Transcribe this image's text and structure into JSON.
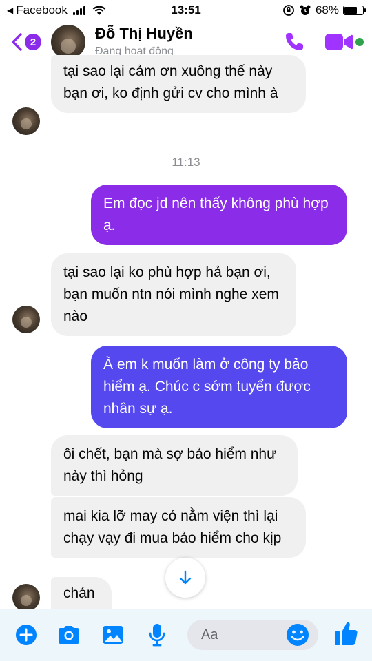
{
  "status_bar": {
    "back_app": "Facebook",
    "time": "13:51",
    "battery_percent": "68%",
    "battery_level": 0.68
  },
  "header": {
    "unread_badge": "2",
    "contact_name": "Đỗ Thị Huyền",
    "contact_status": "Đang hoạt động",
    "online": true
  },
  "messages": [
    {
      "direction": "in",
      "text": "tại sao lại cảm ơn xuông thế này bạn ơi, ko định gửi cv cho mình à"
    },
    {
      "direction": "out",
      "text": "Em đọc jd nên thấy không phù hợp ạ."
    },
    {
      "direction": "in",
      "text": "tại sao lại ko phù hợp hả bạn ơi, bạn muốn ntn nói mình nghe xem nào"
    },
    {
      "direction": "out",
      "text": "À em k muốn làm ở công ty bảo hiểm ạ. Chúc c sớm tuyển được nhân sự ạ."
    },
    {
      "direction": "in",
      "text": "ôi chết, bạn mà sợ bảo hiểm như này thì hỏng"
    },
    {
      "direction": "in",
      "text": "mai kia lỡ may có nằm viện thì lại chạy vạy đi mua bảo hiểm cho kịp"
    },
    {
      "direction": "in",
      "text": "chán"
    }
  ],
  "timestamp": "11:13",
  "composer": {
    "placeholder": "Aa",
    "icons": [
      "plus-icon",
      "camera-icon",
      "image-icon",
      "microphone-icon",
      "emoji-icon",
      "thumbs-up-icon"
    ]
  },
  "colors": {
    "accent": "#0084ff",
    "outgoing_top": "#8a2ce8",
    "outgoing_bottom": "#3b5ff5",
    "incoming_bubble": "#f0f0f0",
    "composer_bg": "#edf6fb",
    "online": "#31a24c"
  }
}
